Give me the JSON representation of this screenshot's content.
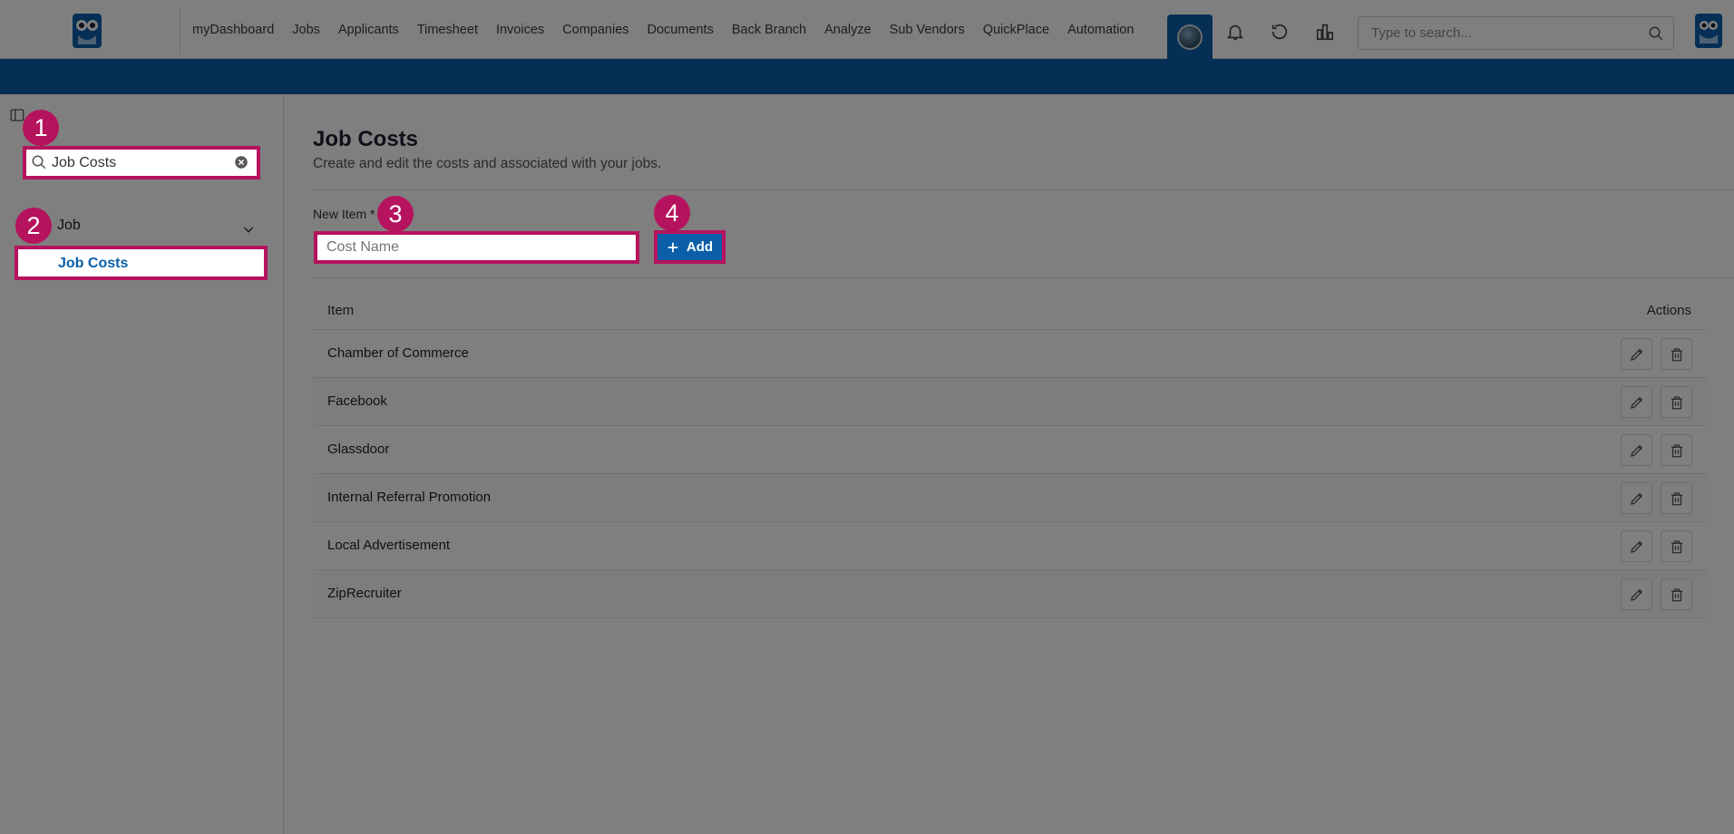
{
  "nav": {
    "items": [
      "myDashboard",
      "Jobs",
      "Applicants",
      "Timesheet",
      "Invoices",
      "Companies",
      "Documents",
      "Back Branch",
      "Analyze",
      "Sub Vendors",
      "QuickPlace",
      "Automation"
    ],
    "search_placeholder": "Type to search..."
  },
  "sidebar": {
    "search_value": "Job Costs",
    "group_label": "Job",
    "item_label": "Job Costs"
  },
  "main": {
    "title": "Job Costs",
    "subtitle": "Create and edit the costs and associated with your jobs.",
    "new_item_label": "New Item",
    "new_item_required": "*",
    "input_placeholder": "Cost Name",
    "add_label": "Add",
    "table": {
      "col_item": "Item",
      "col_actions": "Actions",
      "rows": [
        "Chamber of Commerce",
        "Facebook",
        "Glassdoor",
        "Internal Referral Promotion",
        "Local Advertisement",
        "ZipRecruiter"
      ]
    }
  },
  "steps": [
    "1",
    "2",
    "3",
    "4"
  ],
  "colors": {
    "brand_blue": "#0a5fa8",
    "highlight": "#b5135d"
  }
}
